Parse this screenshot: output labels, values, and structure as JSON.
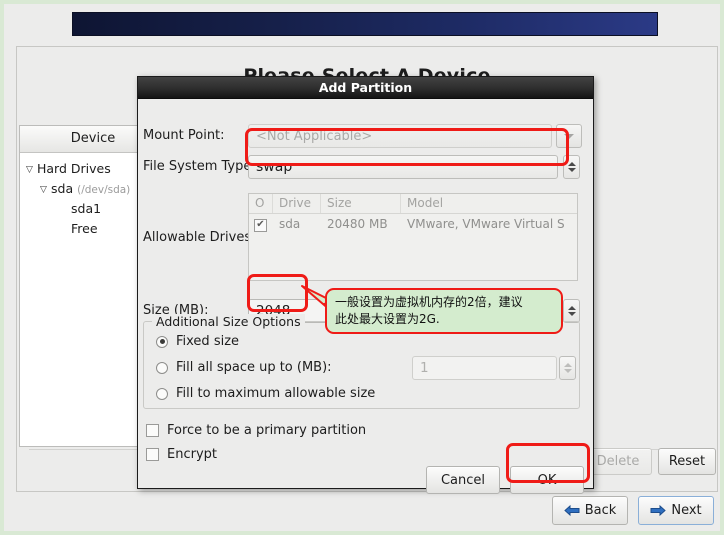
{
  "background": {
    "page_title": "Please Select A Device",
    "tree": {
      "header": "Device",
      "items": [
        {
          "label": "Hard Drives",
          "sub": "",
          "indent": 0,
          "arrow": "▽"
        },
        {
          "label": "sda",
          "sub": "(/dev/sda)",
          "indent": 1,
          "arrow": "▽"
        },
        {
          "label": "sda1",
          "sub": "",
          "indent": 2,
          "arrow": ""
        },
        {
          "label": "Free",
          "sub": "",
          "indent": 2,
          "arrow": ""
        }
      ]
    },
    "actions": {
      "delete_label": "Delete",
      "reset_label": "Reset"
    },
    "nav": {
      "back_label": "Back",
      "next_label": "Next"
    }
  },
  "dialog": {
    "title": "Add Partition",
    "mount_point": {
      "label": "Mount Point:",
      "value": "<Not Applicable>"
    },
    "fs_type": {
      "label": "File System Type:",
      "value": "swap"
    },
    "allowable_drives": {
      "label": "Allowable Drives:",
      "columns": [
        "O",
        "Drive",
        "Size",
        "Model"
      ],
      "rows": [
        {
          "checked": "✔",
          "drive": "sda",
          "size": "20480 MB",
          "model": "VMware, VMware Virtual S"
        }
      ]
    },
    "size": {
      "label": "Size (MB):",
      "value": "2048"
    },
    "additional": {
      "group_label": "Additional Size Options",
      "options": [
        {
          "label": "Fixed size",
          "selected": true
        },
        {
          "label": "Fill all space up to (MB):",
          "selected": false
        },
        {
          "label": "Fill to maximum allowable size",
          "selected": false
        }
      ],
      "fill_value": "1"
    },
    "checkboxes": [
      {
        "label": "Force to be a primary partition",
        "checked": false
      },
      {
        "label": "Encrypt",
        "checked": false
      }
    ],
    "buttons": {
      "cancel_label": "Cancel",
      "ok_label": "OK"
    }
  },
  "annotation": {
    "line1": "一般设置为虚拟机内存的2倍，建议",
    "line2": "此处最大设置为2G."
  },
  "colors": {
    "highlight": "#ef1b17",
    "callout_bg": "#d4ecce",
    "banner_start": "#0e1533",
    "banner_end": "#2b3a86",
    "dialog_titlebar": "#2d2d2d"
  }
}
